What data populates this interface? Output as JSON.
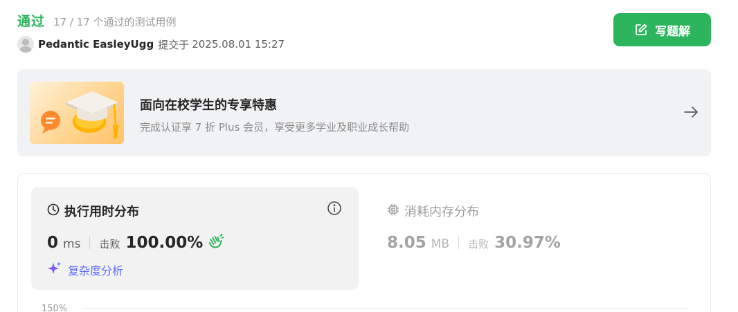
{
  "header": {
    "status": "通过",
    "test_summary": "17 / 17 个通过的测试用例",
    "user_name": "Pedantic EasleyUgg",
    "submitted_label": "提交于",
    "submitted_time": "2025.08.01 15:27",
    "write_solution_label": "写题解"
  },
  "promo": {
    "title": "面向在校学生的专享特惠",
    "subtitle": "完成认证享 7 折 Plus 会员，享受更多学业及职业成长帮助"
  },
  "runtime": {
    "title": "执行用时分布",
    "value": "0",
    "unit": "ms",
    "beats_label": "击败",
    "beats_percent": "100.00%",
    "complexity_link": "复杂度分析"
  },
  "memory": {
    "title": "消耗内存分布",
    "value": "8.05",
    "unit": "MB",
    "beats_label": "击败",
    "beats_percent": "30.97%"
  },
  "chart": {
    "y_tick_label": "150%"
  },
  "colors": {
    "accent_green": "#2db55d",
    "link_purple_blue": "#5b6cff",
    "panel_gray": "#f2f2f3"
  }
}
